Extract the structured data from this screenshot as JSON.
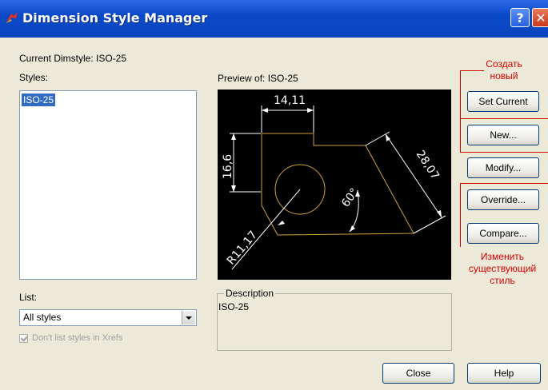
{
  "window": {
    "title": "Dimension Style Manager",
    "help_label": "?",
    "close_label": "✕"
  },
  "current_dimstyle_label": "Current Dimstyle: ISO-25",
  "styles_label": "Styles:",
  "styles_list": [
    "ISO-25"
  ],
  "preview_label": "Preview of: ISO-25",
  "preview_dims": {
    "top": "14,11",
    "left": "16,6",
    "right": "28,07",
    "angle": "60°",
    "radius": "R11,17"
  },
  "list_label": "List:",
  "list_select": {
    "value": "All styles"
  },
  "checkbox": {
    "label": "Don't list styles in Xrefs",
    "checked": true,
    "disabled": true
  },
  "description": {
    "legend": "Description",
    "text": "ISO-25"
  },
  "buttons": {
    "set_current": "Set Current",
    "new": "New...",
    "modify": "Modify...",
    "override": "Override...",
    "compare": "Compare...",
    "close": "Close",
    "help": "Help"
  },
  "annotations": {
    "create_line1": "Создать",
    "create_line2": "новый",
    "modify_line1": "Изменить",
    "modify_line2": "существующий",
    "modify_line3": "стиль"
  },
  "colors": {
    "titlebar": "#0b45c0",
    "annotation": "#d40000",
    "drawing": "#d4a040",
    "selection": "#316ac5"
  }
}
